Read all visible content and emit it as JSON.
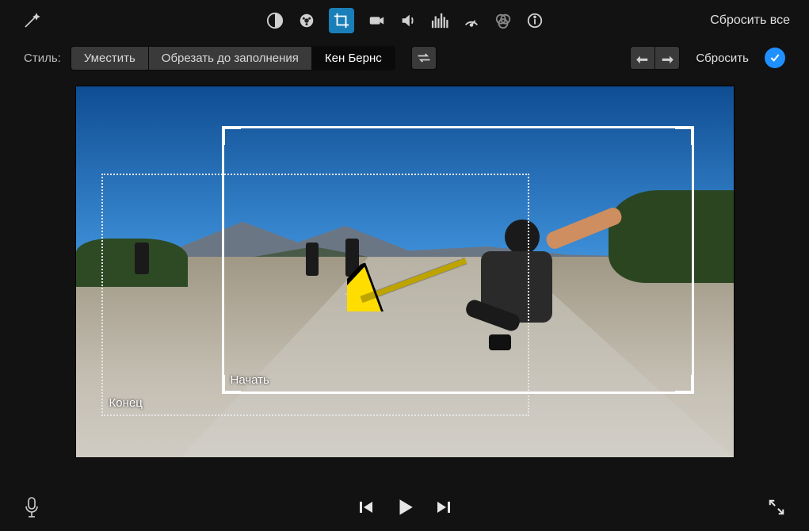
{
  "toolbar": {
    "reset_all": "Сбросить все",
    "icons": {
      "wand": "magic-wand-icon",
      "balance": "color-balance-icon",
      "palette": "color-wheel-icon",
      "crop": "crop-icon",
      "camera": "video-effects-icon",
      "volume": "volume-icon",
      "eq": "equalizer-icon",
      "speed": "speedometer-icon",
      "filters": "color-filters-icon",
      "info": "info-icon"
    }
  },
  "options": {
    "style_label": "Стиль:",
    "fit": "Уместить",
    "fill": "Обрезать до заполнения",
    "kenburns": "Кен Бернс",
    "swap": "↔",
    "rotate_ccw": "⟲",
    "rotate_cw": "⟳",
    "reset": "Сбросить"
  },
  "viewer": {
    "start_label": "Начать",
    "end_label": "Конец"
  },
  "bottom": {
    "mic": "microphone-icon",
    "prev": "previous-icon",
    "play": "play-icon",
    "next": "next-icon",
    "expand": "fullscreen-icon"
  }
}
